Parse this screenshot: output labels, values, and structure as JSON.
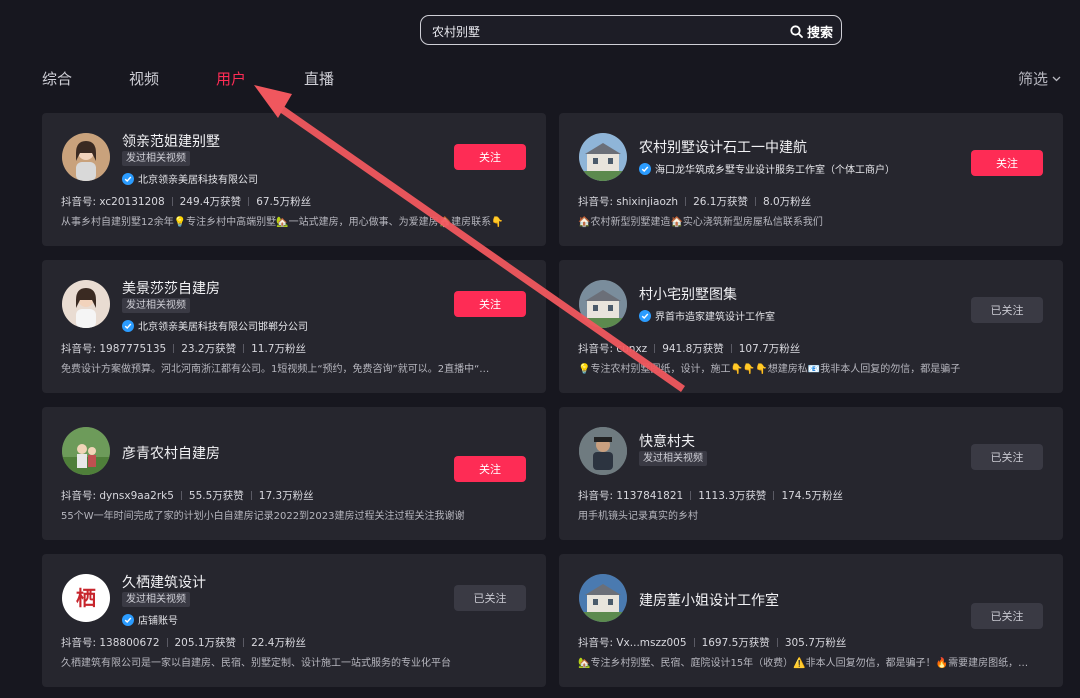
{
  "search": {
    "query": "农村别墅",
    "button_label": "搜索"
  },
  "tabs": [
    {
      "label": "综合",
      "active": false
    },
    {
      "label": "视频",
      "active": false
    },
    {
      "label": "用户",
      "active": true
    },
    {
      "label": "直播",
      "active": false
    }
  ],
  "filter_label": "筛选",
  "cards": [
    {
      "name": "领亲范姐建别墅",
      "tag": "发过相关视频",
      "verify": "北京领亲美居科技有限公司",
      "id": "抖音号: xc20131208",
      "likes": "249.4万获赞",
      "fans": "67.5万粉丝",
      "bio": "从事乡村自建别墅12余年💡专注乡村中高端别墅🏡一站式建房，用心做事、为爱建房🏠建房联系👇",
      "button": "关注",
      "followed": false
    },
    {
      "name": "农村别墅设计石工一中建航",
      "tag": "",
      "verify": "海口龙华筑成乡墅专业设计服务工作室（个体工商户）",
      "id": "抖音号: shixinjiaozh",
      "likes": "26.1万获赞",
      "fans": "8.0万粉丝",
      "bio": "🏠农村新型别墅建造🏠实心浇筑新型房屋私信联系我们",
      "button": "关注",
      "followed": false
    },
    {
      "name": "美景莎莎自建房",
      "tag": "发过相关视频",
      "verify": "北京领亲美居科技有限公司邯郸分公司",
      "id": "抖音号: 1987775135",
      "likes": "23.2万获赞",
      "fans": "11.7万粉丝",
      "bio": "免费设计方案做预算。河北河南浙江都有公司。1短视频上“预约，免费咨询”就可以。2直播中“…",
      "button": "关注",
      "followed": false
    },
    {
      "name": "村小宅别墅图集",
      "tag": "",
      "verify": "界首市造家建筑设计工作室",
      "id": "抖音号: cunxz",
      "likes": "941.8万获赞",
      "fans": "107.7万粉丝",
      "bio": "💡专注农村别墅图纸，设计，施工👇👇👇想建房私📧我非本人回复的勿信，都是骗子",
      "button": "已关注",
      "followed": true
    },
    {
      "name": "彦青农村自建房",
      "tag": "",
      "verify": "",
      "id": "抖音号: dynsx9aa2rk5",
      "likes": "55.5万获赞",
      "fans": "17.3万粉丝",
      "bio": "55个W一年时间完成了家的计划小白自建房记录2022到2023建房过程关注过程关注我谢谢",
      "button": "关注",
      "followed": false
    },
    {
      "name": "快意村夫",
      "tag": "发过相关视频",
      "verify": "",
      "id": "抖音号: 1137841821",
      "likes": "1113.3万获赞",
      "fans": "174.5万粉丝",
      "bio": "用手机镜头记录真实的乡村",
      "button": "已关注",
      "followed": true
    },
    {
      "name": "久栖建筑设计",
      "tag": "发过相关视频",
      "verify": "店铺账号",
      "id": "抖音号: 138800672",
      "likes": "205.1万获赞",
      "fans": "22.4万粉丝",
      "bio": "久栖建筑有限公司是一家以自建房、民宿、别墅定制、设计施工一站式服务的专业化平台",
      "button": "已关注",
      "followed": true
    },
    {
      "name": "建房董小姐设计工作室",
      "tag": "",
      "verify": "",
      "id": "抖音号: Vx...mszz005",
      "likes": "1697.5万获赞",
      "fans": "305.7万粉丝",
      "bio": "🏡专注乡村别墅、民宿、庭院设计15年（收费）⚠️非本人回复勿信，都是骗子！🔥需要建房图纸，…",
      "button": "已关注",
      "followed": true
    }
  ],
  "colors": {
    "accent": "#fe2c55",
    "background": "#17171f",
    "card": "#26262e",
    "annotation_arrow": "#f0575e"
  },
  "logo_text": "栖"
}
